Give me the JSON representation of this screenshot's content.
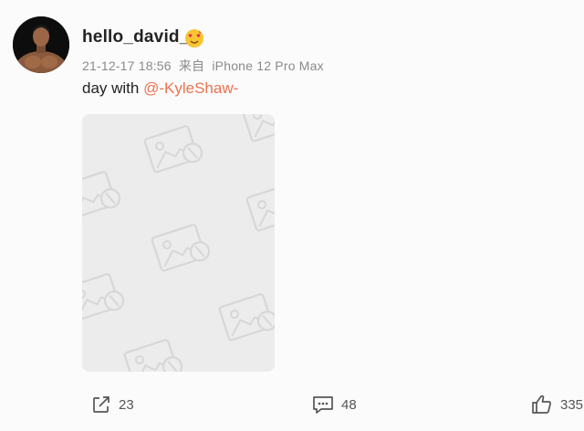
{
  "post": {
    "username": "hello_david_",
    "timestamp": "21-12-17 18:56",
    "source_prefix": "来自",
    "device": "iPhone 12 Pro Max",
    "text_prefix": "day with ",
    "mention": "@-KyleShaw-"
  },
  "actions": {
    "share_count": "23",
    "comment_count": "48",
    "like_count": "335"
  },
  "icons": {
    "avatar": "avatar",
    "badge": "emoji-badge-icon",
    "share": "share-icon",
    "comment": "comment-icon",
    "like": "thumbs-up-icon",
    "placeholder": "image-placeholder-icon"
  },
  "colors": {
    "mention": "#eb7350",
    "meta_text": "#8a8a8a",
    "placeholder_bg": "#ececec"
  }
}
